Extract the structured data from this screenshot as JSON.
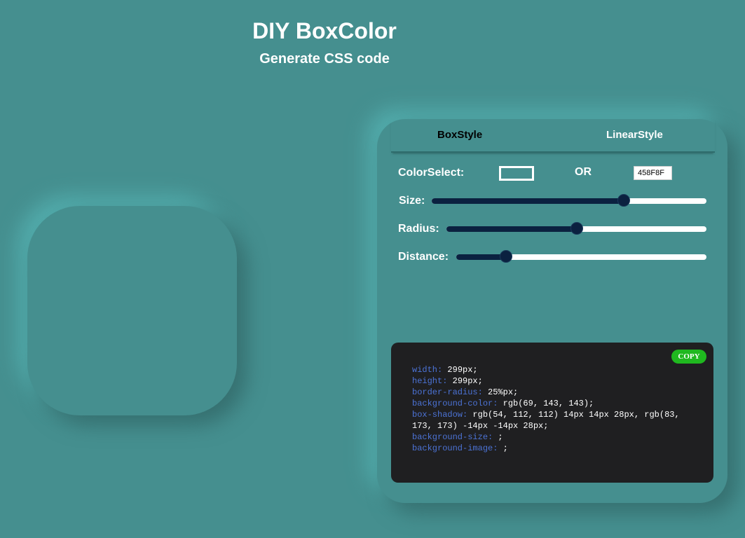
{
  "header": {
    "title": "DIY BoxColor",
    "subtitle": "Generate CSS code"
  },
  "preview": {
    "background_color": "#458F8F"
  },
  "tabs": [
    {
      "label": "BoxStyle",
      "active": true
    },
    {
      "label": "LinearStyle",
      "active": false
    }
  ],
  "controls": {
    "color_label": "ColorSelect:",
    "or_label": "OR",
    "hex_value": "458F8F",
    "size": {
      "label": "Size:",
      "value_fraction": 0.7
    },
    "radius": {
      "label": "Radius:",
      "value_fraction": 0.5
    },
    "distance": {
      "label": "Distance:",
      "value_fraction": 0.2
    }
  },
  "code": {
    "copy_label": "COPY",
    "lines": [
      {
        "prop": "width:",
        "value": " 299px;"
      },
      {
        "prop": "height:",
        "value": " 299px;"
      },
      {
        "prop": "border-radius:",
        "value": " 25%px;"
      },
      {
        "prop": "background-color:",
        "value": " rgb(69, 143, 143);"
      },
      {
        "prop": "box-shadow:",
        "value": " rgb(54, 112, 112) 14px 14px 28px, rgb(83, 173, 173) -14px -14px 28px;"
      },
      {
        "prop": "background-size:",
        "value": " ;"
      },
      {
        "prop": "background-image:",
        "value": " ;"
      }
    ]
  },
  "colors": {
    "page_bg": "#458F8F",
    "slider_fill": "#0b2140",
    "code_bg": "#1f1f21",
    "copy_button": "#1fb81f",
    "code_property": "#4c73d6"
  }
}
